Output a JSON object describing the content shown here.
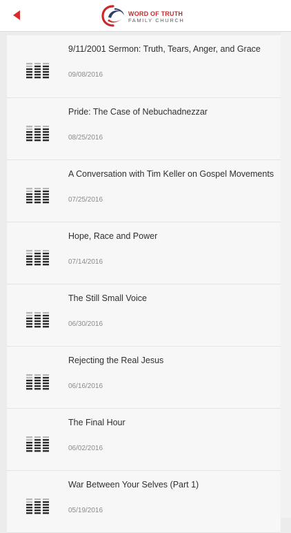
{
  "header": {
    "back_icon": "back-arrow-icon",
    "logo": {
      "line1": "WORD OF TRUTH",
      "line2": "FAMILY CHURCH",
      "colors": {
        "red": "#c9292b",
        "navy": "#2b3f6b",
        "gray": "#5b5b5b"
      }
    },
    "accent_color": "#d92b2b"
  },
  "sermons": [
    {
      "title": "9/11/2001 Sermon: Truth, Tears, Anger, and Grace",
      "date": "09/08/2016",
      "icon": "audio-levels-icon"
    },
    {
      "title": "Pride: The Case of Nebuchadnezzar",
      "date": "08/25/2016",
      "icon": "audio-levels-icon"
    },
    {
      "title": "A Conversation with Tim Keller on Gospel Movements",
      "date": "07/25/2016",
      "icon": "audio-levels-icon"
    },
    {
      "title": "Hope, Race and Power",
      "date": "07/14/2016",
      "icon": "audio-levels-icon"
    },
    {
      "title": "The Still Small Voice",
      "date": "06/30/2016",
      "icon": "audio-levels-icon"
    },
    {
      "title": "Rejecting the Real Jesus",
      "date": "06/16/2016",
      "icon": "audio-levels-icon"
    },
    {
      "title": "The Final Hour",
      "date": "06/02/2016",
      "icon": "audio-levels-icon"
    },
    {
      "title": "War Between Your Selves (Part 1)",
      "date": "05/19/2016",
      "icon": "audio-levels-icon"
    }
  ]
}
